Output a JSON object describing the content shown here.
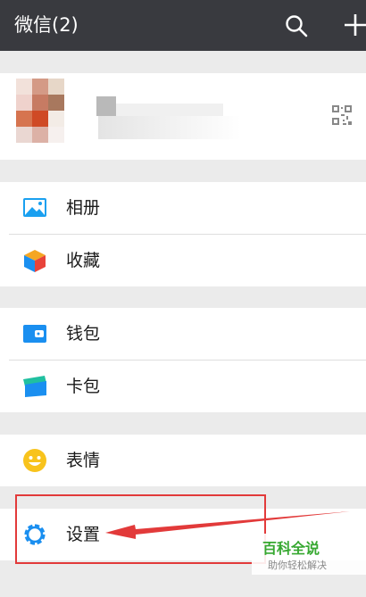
{
  "header": {
    "title": "微信(2)",
    "search_icon": "search-icon",
    "add_icon": "plus-icon"
  },
  "profile": {
    "qr_icon": "qr-code-icon"
  },
  "menu": {
    "album": {
      "label": "相册",
      "icon": "picture-icon",
      "color": "#1aa0f0"
    },
    "favorites": {
      "label": "收藏",
      "icon": "cube-icon",
      "color": "#f5a623"
    },
    "wallet": {
      "label": "钱包",
      "icon": "wallet-icon",
      "color": "#1a8ff0"
    },
    "cards": {
      "label": "卡包",
      "icon": "card-icon",
      "color": "#1aaad6"
    },
    "stickers": {
      "label": "表情",
      "icon": "smiley-icon",
      "color": "#f8c31c"
    },
    "settings": {
      "label": "设置",
      "icon": "gear-icon",
      "color": "#1a8ff0"
    }
  },
  "annotation": {
    "color": "#e23a3a"
  },
  "watermark": {
    "title": "百科全说",
    "subtitle": "助你轻松解决"
  },
  "colors": {
    "header_bg": "#393a3f",
    "page_bg": "#ebebeb"
  }
}
